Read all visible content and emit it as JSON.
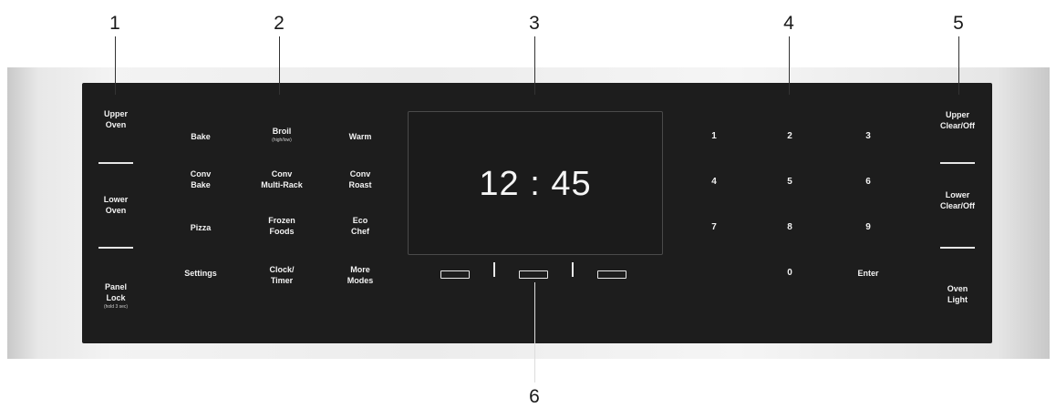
{
  "callouts": [
    "1",
    "2",
    "3",
    "4",
    "5",
    "6"
  ],
  "left_column": {
    "upper_oven": [
      "Upper",
      "Oven"
    ],
    "lower_oven": [
      "Lower",
      "Oven"
    ],
    "panel_lock": [
      "Panel",
      "Lock"
    ],
    "panel_lock_note": "(hold 3 sec)"
  },
  "modes": {
    "bake": "Bake",
    "broil": "Broil",
    "broil_note": "(high/low)",
    "warm": "Warm",
    "conv_bake": [
      "Conv",
      "Bake"
    ],
    "conv_multi_rack": [
      "Conv",
      "Multi-Rack"
    ],
    "conv_roast": [
      "Conv",
      "Roast"
    ],
    "pizza": "Pizza",
    "frozen_foods": [
      "Frozen",
      "Foods"
    ],
    "eco_chef": [
      "Eco",
      "Chef"
    ],
    "settings": "Settings",
    "clock_timer": [
      "Clock/",
      "Timer"
    ],
    "more_modes": [
      "More",
      "Modes"
    ]
  },
  "display": {
    "time": "12 : 45"
  },
  "keypad": {
    "keys": [
      "1",
      "2",
      "3",
      "4",
      "5",
      "6",
      "7",
      "8",
      "9",
      "0"
    ],
    "enter": "Enter"
  },
  "right_column": {
    "upper_clear": [
      "Upper",
      "Clear/Off"
    ],
    "lower_clear": [
      "Lower",
      "Clear/Off"
    ],
    "oven_light": [
      "Oven",
      "Light"
    ]
  },
  "colors": {
    "panel": "#1d1d1d",
    "text": "#f2f2f2",
    "steel": "#ececec"
  }
}
